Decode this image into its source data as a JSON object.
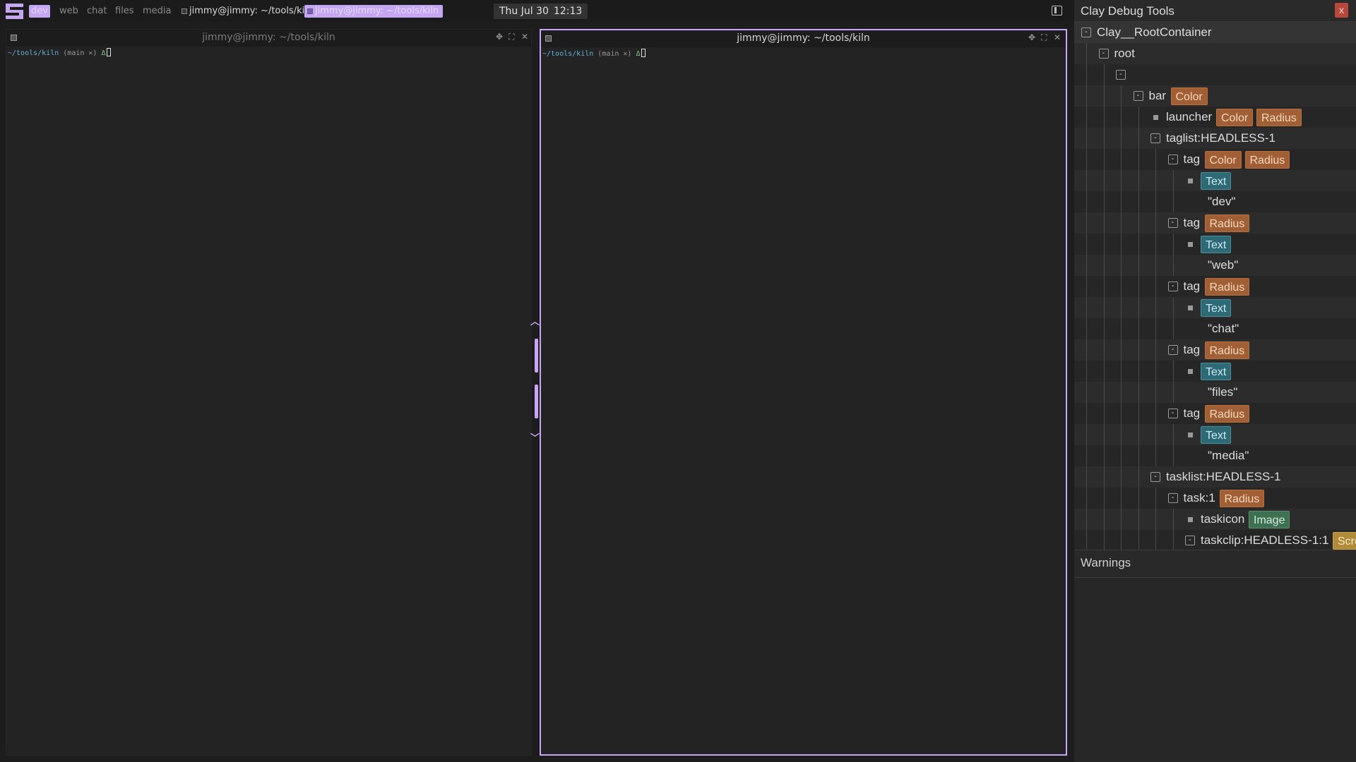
{
  "topbar": {
    "tags": [
      "dev",
      "web",
      "chat",
      "files",
      "media"
    ],
    "active_tag": "dev",
    "tasks": [
      {
        "title": "jimmy@jimmy: ~/tools/kiln",
        "focused": false
      },
      {
        "title": "jimmy@jimmy: ~/tools/kiln",
        "focused": true
      }
    ],
    "clock": {
      "date": "Thu Jul 30",
      "time": "12:13"
    },
    "accent": "#c4a7f2"
  },
  "terminals": [
    {
      "title": "jimmy@jimmy: ~/tools/kiln",
      "cwd": "~/tools/kiln",
      "branch": "(main ✕)",
      "prompt": "Δ",
      "focused": false
    },
    {
      "title": "jimmy@jimmy: ~/tools/kiln",
      "cwd": "~/tools/kiln",
      "branch": "(main ✕)",
      "prompt": "Δ",
      "focused": true
    }
  ],
  "debug": {
    "title": "Clay Debug Tools",
    "close_label": "x",
    "warnings_label": "Warnings",
    "tree": [
      {
        "depth": 0,
        "kind": "toggle",
        "label": "Clay__RootContainer",
        "badges": []
      },
      {
        "depth": 1,
        "kind": "toggle",
        "label": "root",
        "badges": []
      },
      {
        "depth": 2,
        "kind": "toggle",
        "label": "",
        "badges": []
      },
      {
        "depth": 3,
        "kind": "toggle",
        "label": "bar",
        "badges": [
          "Color"
        ]
      },
      {
        "depth": 4,
        "kind": "leaf",
        "label": "launcher",
        "badges": [
          "Color",
          "Radius"
        ]
      },
      {
        "depth": 4,
        "kind": "toggle",
        "label": "taglist:HEADLESS-1",
        "badges": []
      },
      {
        "depth": 5,
        "kind": "toggle",
        "label": "tag",
        "badges": [
          "Color",
          "Radius"
        ]
      },
      {
        "depth": 6,
        "kind": "leaf",
        "label": "",
        "badges": [
          "Text"
        ]
      },
      {
        "depth": 6,
        "kind": "text",
        "label": "\"dev\"",
        "badges": []
      },
      {
        "depth": 5,
        "kind": "toggle",
        "label": "tag",
        "badges": [
          "Radius"
        ]
      },
      {
        "depth": 6,
        "kind": "leaf",
        "label": "",
        "badges": [
          "Text"
        ]
      },
      {
        "depth": 6,
        "kind": "text",
        "label": "\"web\"",
        "badges": []
      },
      {
        "depth": 5,
        "kind": "toggle",
        "label": "tag",
        "badges": [
          "Radius"
        ]
      },
      {
        "depth": 6,
        "kind": "leaf",
        "label": "",
        "badges": [
          "Text"
        ]
      },
      {
        "depth": 6,
        "kind": "text",
        "label": "\"chat\"",
        "badges": []
      },
      {
        "depth": 5,
        "kind": "toggle",
        "label": "tag",
        "badges": [
          "Radius"
        ]
      },
      {
        "depth": 6,
        "kind": "leaf",
        "label": "",
        "badges": [
          "Text"
        ]
      },
      {
        "depth": 6,
        "kind": "text",
        "label": "\"files\"",
        "badges": []
      },
      {
        "depth": 5,
        "kind": "toggle",
        "label": "tag",
        "badges": [
          "Radius"
        ]
      },
      {
        "depth": 6,
        "kind": "leaf",
        "label": "",
        "badges": [
          "Text"
        ]
      },
      {
        "depth": 6,
        "kind": "text",
        "label": "\"media\"",
        "badges": []
      },
      {
        "depth": 4,
        "kind": "toggle",
        "label": "tasklist:HEADLESS-1",
        "badges": []
      },
      {
        "depth": 5,
        "kind": "toggle",
        "label": "task:1",
        "badges": [
          "Radius"
        ]
      },
      {
        "depth": 6,
        "kind": "leaf",
        "label": "taskicon",
        "badges": [
          "Image"
        ]
      },
      {
        "depth": 6,
        "kind": "toggle",
        "label": "taskclip:HEADLESS-1:1",
        "badges": [
          "Scroll"
        ]
      }
    ]
  }
}
